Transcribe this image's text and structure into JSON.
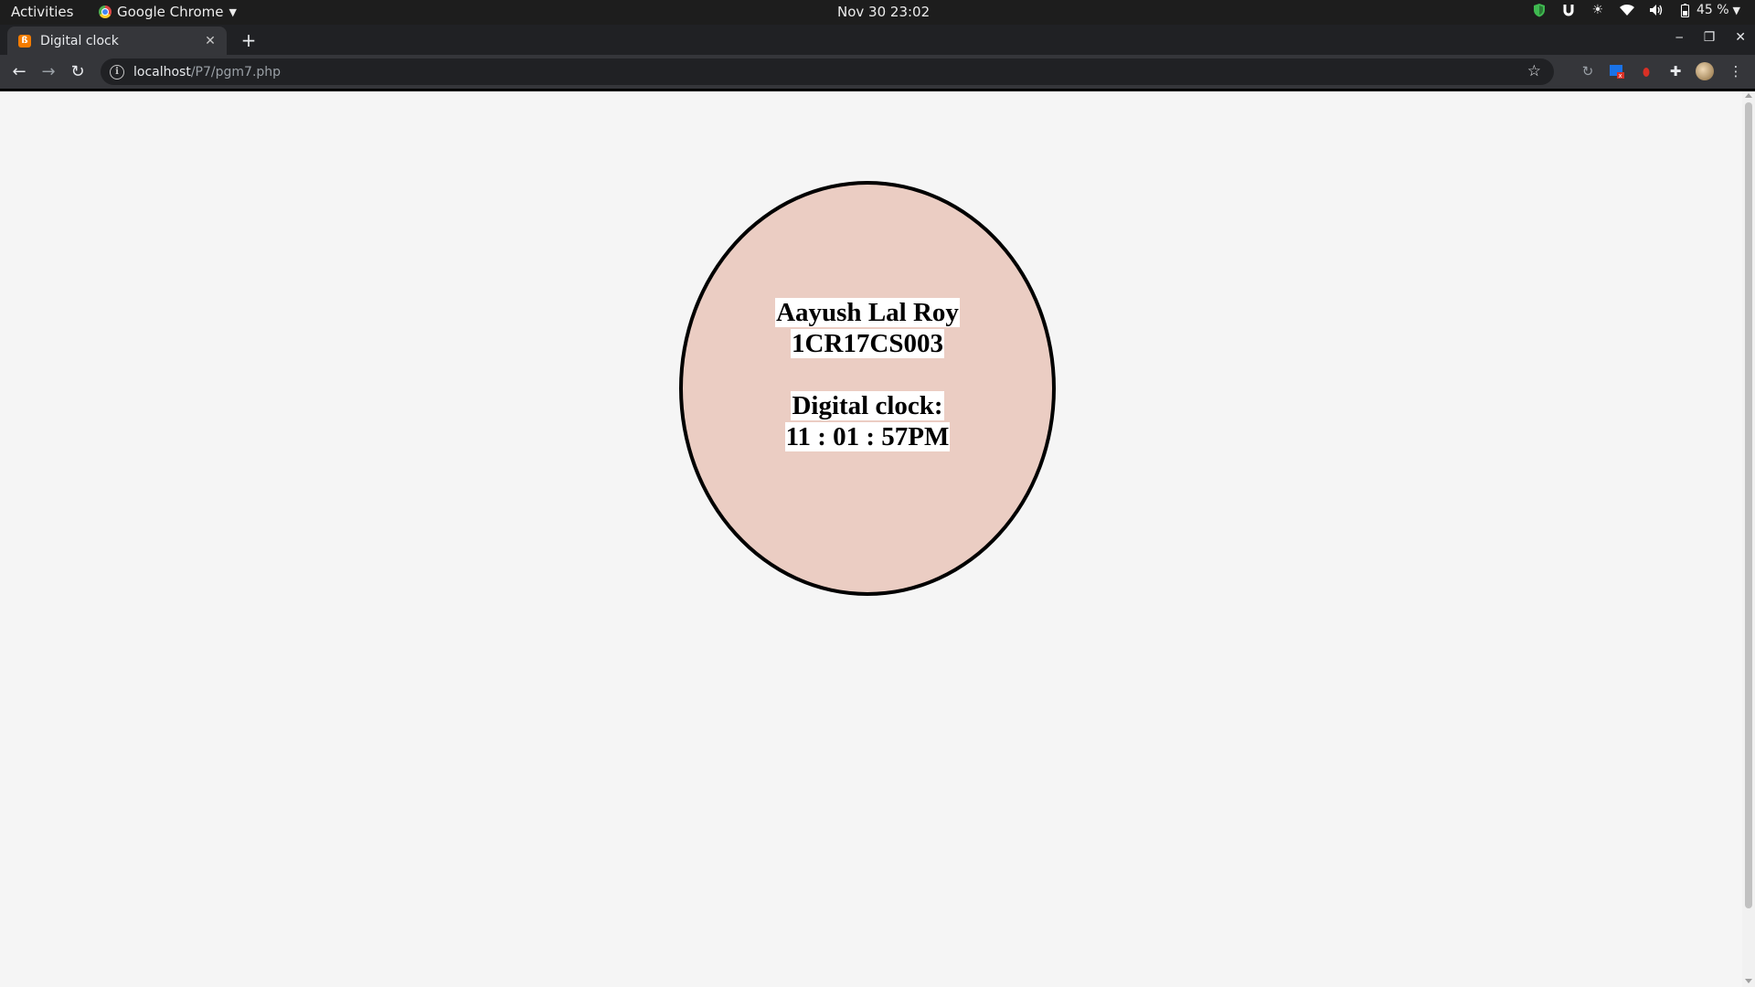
{
  "system": {
    "activities": "Activities",
    "app_name": "Google Chrome",
    "datetime": "Nov 30  23:02",
    "battery": "45 %"
  },
  "browser": {
    "tab_title": "Digital clock",
    "url_host": "localhost",
    "url_path": "/P7/pgm7.php"
  },
  "page": {
    "name": "Aayush Lal Roy",
    "usn": "1CR17CS003",
    "clock_label": "Digital clock:",
    "clock_time": "11 : 01 : 57PM",
    "circle_color": "#ebcdc3"
  }
}
